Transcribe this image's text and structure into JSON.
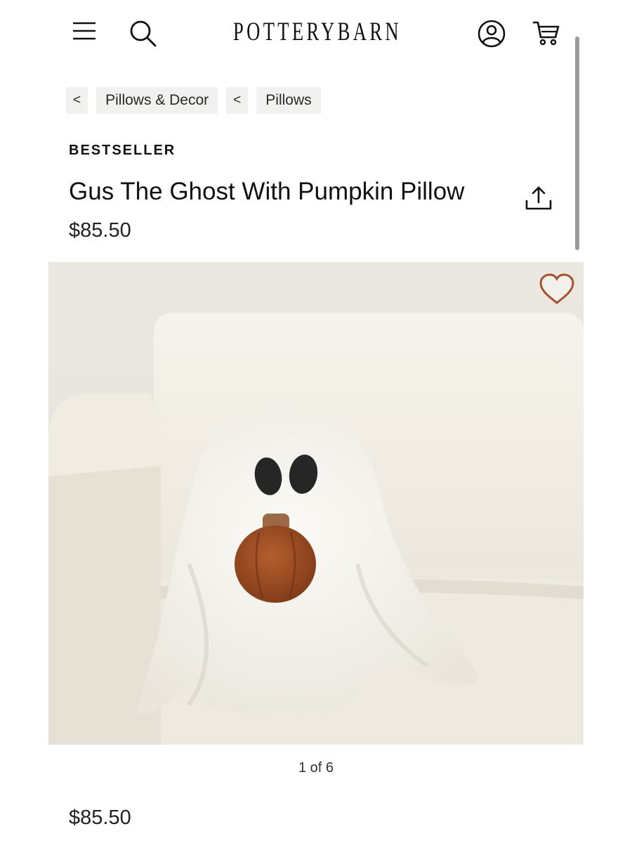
{
  "header": {
    "logo": "POTTERYBARN",
    "icons": {
      "menu": "menu-icon",
      "search": "search-icon",
      "account": "account-icon",
      "cart": "cart-icon"
    }
  },
  "breadcrumb": {
    "items": [
      {
        "chevron": "<",
        "label": "Pillows & Decor"
      },
      {
        "chevron": "<",
        "label": "Pillows"
      }
    ]
  },
  "product": {
    "badge": "BESTSELLER",
    "title": "Gus The Ghost With Pumpkin Pillow",
    "price": "$85.50",
    "image_counter": "1 of 6",
    "price_bottom": "$85.50",
    "share_icon": "share-icon",
    "wishlist_icon": "heart-icon"
  },
  "colors": {
    "accent": "#a6522c",
    "text": "#111111",
    "breadcrumb_bg": "#f1f1ef"
  }
}
